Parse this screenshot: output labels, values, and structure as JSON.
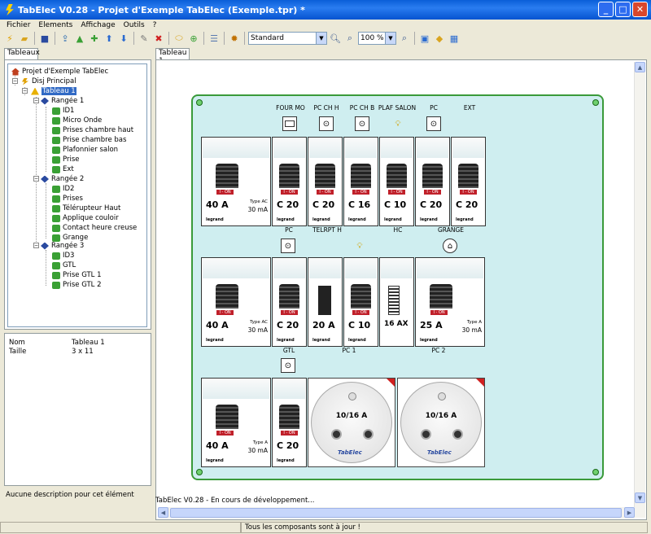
{
  "window": {
    "title": "TabElec V0.28 - Projet d'Exemple TabElec (Exemple.tpr) *",
    "buttons": [
      "_",
      "□",
      "✕"
    ]
  },
  "menu": [
    "Fichier",
    "Elements",
    "Affichage",
    "Outils",
    "?"
  ],
  "toolbar": {
    "style_select": "Standard",
    "zoom_select": "100 %"
  },
  "left_tab": "Tableaux",
  "tree": {
    "project": "Projet d'Exemple TabElec",
    "disj": "Disj Principal",
    "tableau": "Tableau 1",
    "rangees": [
      {
        "label": "Rangée 1",
        "items": [
          "ID1",
          "Micro Onde",
          "Prises chambre haut",
          "Prise chambre bas",
          "Plafonnier salon",
          "Prise",
          "Ext"
        ]
      },
      {
        "label": "Rangée 2",
        "items": [
          "ID2",
          "Prises",
          "Télérupteur Haut",
          "Applique couloir",
          "Contact heure creuse",
          "Grange"
        ]
      },
      {
        "label": "Rangée 3",
        "items": [
          "ID3",
          "GTL",
          "Prise GTL 1",
          "Prise GTL 2"
        ]
      }
    ]
  },
  "props": [
    {
      "k": "Nom",
      "v": "Tableau 1"
    },
    {
      "k": "Taille",
      "v": "3 x 11"
    }
  ],
  "description": "Aucune description pour cet élément",
  "right_tab": "Tableau 1",
  "board": {
    "row1_top_labels": [
      "FOUR MO",
      "PC CH H",
      "PC CH B",
      "PLAF SALON",
      "PC",
      "EXT"
    ],
    "row1_modules": [
      "40 A",
      "C 20",
      "C 20",
      "C 16",
      "C 10",
      "C 20",
      "C 20"
    ],
    "row1_type": "Type AC",
    "row1_ma": "30 mA",
    "row2_top_labels": [
      "PC",
      "TELRPT H",
      "HC",
      "GRANGE"
    ],
    "row2_modules": [
      "40 A",
      "C 20",
      "20 A",
      "C 10",
      "16 AX",
      "25 A"
    ],
    "row2_type": "Type AC",
    "row2_ma": "30 mA",
    "row2_contact_type": "Type A",
    "row3_top_labels": [
      "GTL",
      "PC 1",
      "PC 2"
    ],
    "row3_modules": [
      "40 A",
      "C 20"
    ],
    "row3_type": "Type A",
    "row3_ma": "30 mA",
    "socket_rating": "10/16 A",
    "socket_brand": "TabElec",
    "brand": "legrand",
    "on": "I - ON"
  },
  "status_message": "TabElec V0.28 - En cours de développement...",
  "statusbar": "Tous les composants sont à jour !",
  "colors": {
    "board_bg": "#cfeef0",
    "board_border": "#3a9a3a",
    "selection": "#316ac5"
  }
}
